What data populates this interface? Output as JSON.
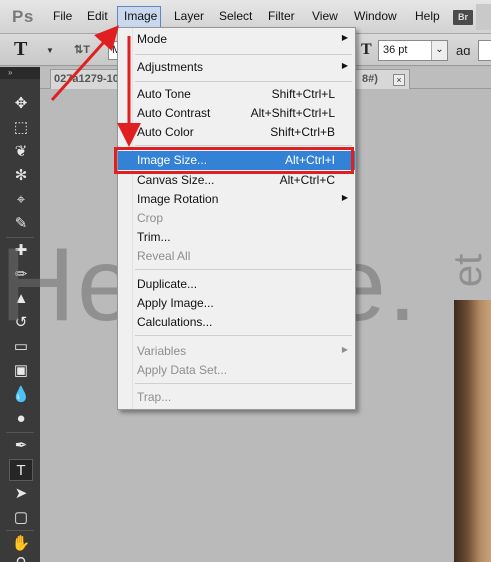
{
  "app": {
    "logo": "Ps"
  },
  "menubar": {
    "items": [
      "File",
      "Edit",
      "Image",
      "Layer",
      "Select",
      "Filter",
      "View",
      "Window",
      "Help"
    ],
    "bridge_badge": "Br"
  },
  "options": {
    "tool_glyph": "T",
    "font_family_partial": "M",
    "font_size": "36 pt",
    "size_glyph": "T",
    "aa_glyph": "aɑ"
  },
  "document": {
    "tab_title": "027a1279-10",
    "tab_suffix": "8#)",
    "close_glyph": "×"
  },
  "watermark": {
    "main": "HeBeLe.",
    "side": "et"
  },
  "image_menu": {
    "items": [
      {
        "label": "Mode",
        "shortcut": "",
        "submenu": true,
        "disabled": false
      },
      {
        "label": "Adjustments",
        "shortcut": "",
        "submenu": true,
        "disabled": false
      },
      {
        "label": "Auto Tone",
        "shortcut": "Shift+Ctrl+L",
        "submenu": false,
        "disabled": false
      },
      {
        "label": "Auto Contrast",
        "shortcut": "Alt+Shift+Ctrl+L",
        "submenu": false,
        "disabled": false
      },
      {
        "label": "Auto Color",
        "shortcut": "Shift+Ctrl+B",
        "submenu": false,
        "disabled": false
      },
      {
        "label": "Image Size...",
        "shortcut": "Alt+Ctrl+I",
        "submenu": false,
        "disabled": false,
        "highlighted": true
      },
      {
        "label": "Canvas Size...",
        "shortcut": "Alt+Ctrl+C",
        "submenu": false,
        "disabled": false
      },
      {
        "label": "Image Rotation",
        "shortcut": "",
        "submenu": true,
        "disabled": false
      },
      {
        "label": "Crop",
        "shortcut": "",
        "submenu": false,
        "disabled": true
      },
      {
        "label": "Trim...",
        "shortcut": "",
        "submenu": false,
        "disabled": false
      },
      {
        "label": "Reveal All",
        "shortcut": "",
        "submenu": false,
        "disabled": true
      },
      {
        "label": "Duplicate...",
        "shortcut": "",
        "submenu": false,
        "disabled": false
      },
      {
        "label": "Apply Image...",
        "shortcut": "",
        "submenu": false,
        "disabled": false
      },
      {
        "label": "Calculations...",
        "shortcut": "",
        "submenu": false,
        "disabled": false
      },
      {
        "label": "Variables",
        "shortcut": "",
        "submenu": true,
        "disabled": true
      },
      {
        "label": "Apply Data Set...",
        "shortcut": "",
        "submenu": false,
        "disabled": true
      },
      {
        "label": "Trap...",
        "shortcut": "",
        "submenu": false,
        "disabled": true
      }
    ]
  },
  "colors": {
    "highlight": "#3382d6",
    "annotation": "#e02020",
    "panel": "#3a3a3a"
  }
}
